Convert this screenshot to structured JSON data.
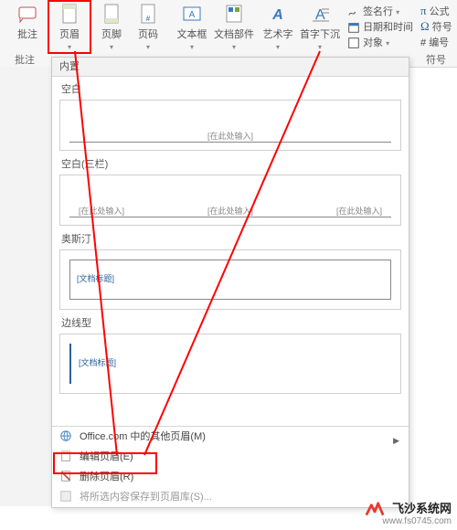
{
  "ribbon": {
    "buttons": {
      "批注": "批注",
      "页眉": "页眉",
      "页脚": "页脚",
      "页码": "页码",
      "文本框": "文本框",
      "文档部件": "文档部件",
      "艺术字": "艺术字",
      "首字下沉": "首字下沉",
      "签名行": "签名行",
      "日期和时间": "日期和时间",
      "对象": "对象",
      "公式": "公式",
      "符号": "符号",
      "编号": "编号"
    },
    "groups": {
      "批注g": "批注",
      "符号g": "符号"
    }
  },
  "panel": {
    "header": "内置",
    "items": {
      "blank": {
        "caption": "空白",
        "placeholder": "[在此处输入]"
      },
      "blank3": {
        "caption": "空白(三栏)",
        "ph1": "[在此处输入]",
        "ph2": "[在此处输入]",
        "ph3": "[在此处输入]"
      },
      "austin": {
        "caption": "奥斯汀",
        "placeholder": "[文档标题]"
      },
      "sideline": {
        "caption": "边线型",
        "placeholder": "[文档标题]"
      }
    },
    "menu": {
      "office": "Office.com 中的其他页眉(M)",
      "edit": "编辑页眉(E)",
      "remove": "删除页眉(R)",
      "save": "将所选内容保存到页眉库(S)..."
    }
  },
  "watermark": {
    "brand": "飞沙系统网",
    "url": "www.fs0745.com"
  }
}
